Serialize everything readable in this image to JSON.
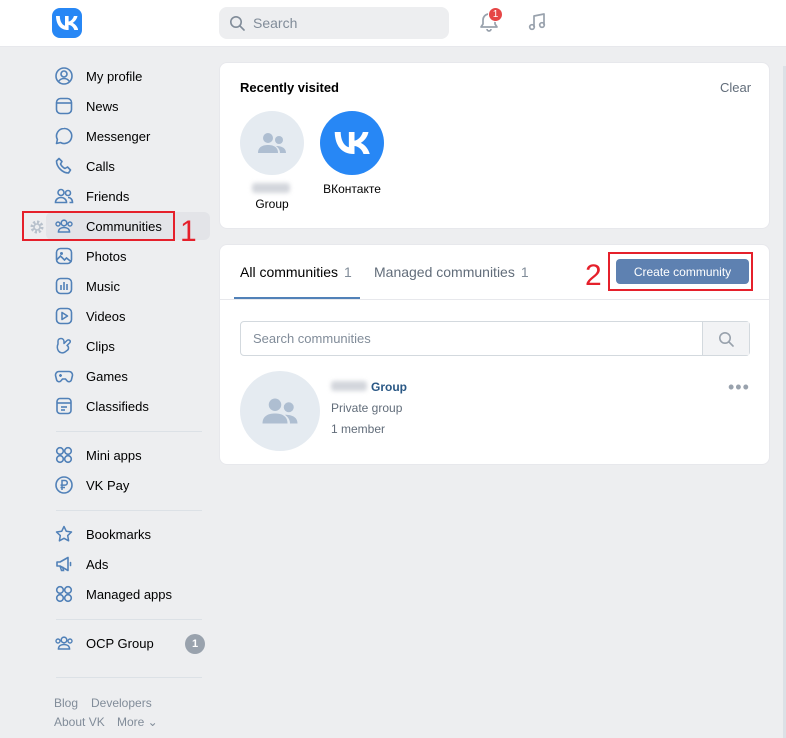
{
  "header": {
    "search_placeholder": "Search",
    "notification_count": "1"
  },
  "sidebar": {
    "items": [
      {
        "label": "My profile",
        "icon": "user-circle-icon"
      },
      {
        "label": "News",
        "icon": "news-icon"
      },
      {
        "label": "Messenger",
        "icon": "message-icon"
      },
      {
        "label": "Calls",
        "icon": "phone-icon"
      },
      {
        "label": "Friends",
        "icon": "friends-icon"
      },
      {
        "label": "Communities",
        "icon": "communities-icon",
        "active": true
      },
      {
        "label": "Photos",
        "icon": "photo-icon"
      },
      {
        "label": "Music",
        "icon": "music-icon"
      },
      {
        "label": "Videos",
        "icon": "video-icon"
      },
      {
        "label": "Clips",
        "icon": "clips-icon"
      },
      {
        "label": "Games",
        "icon": "gamepad-icon"
      },
      {
        "label": "Classifieds",
        "icon": "classifieds-icon"
      }
    ],
    "items2": [
      {
        "label": "Mini apps",
        "icon": "apps-icon"
      },
      {
        "label": "VK Pay",
        "icon": "ruble-icon"
      }
    ],
    "items3": [
      {
        "label": "Bookmarks",
        "icon": "star-icon"
      },
      {
        "label": "Ads",
        "icon": "megaphone-icon"
      },
      {
        "label": "Managed apps",
        "icon": "apps-icon"
      }
    ],
    "group_item": {
      "label": "OCP Group",
      "counter": "1"
    },
    "footer": {
      "blog": "Blog",
      "developers": "Developers",
      "about": "About VK",
      "more": "More ⌄"
    }
  },
  "recently_visited": {
    "title": "Recently visited",
    "clear": "Clear",
    "items": [
      {
        "label": "Group"
      },
      {
        "label": "ВКонтакте"
      }
    ]
  },
  "communities": {
    "tabs": [
      {
        "label": "All communities",
        "count": "1"
      },
      {
        "label": "Managed communities",
        "count": "1"
      }
    ],
    "create_button": "Create community",
    "search_placeholder": "Search communities",
    "group": {
      "name": "Group",
      "type": "Private group",
      "members": "1 member"
    }
  },
  "annotations": {
    "step1": "1",
    "step2": "2"
  },
  "colors": {
    "accent": "#2787f5",
    "button": "#5e81b1",
    "annotation": "#e5202b"
  }
}
